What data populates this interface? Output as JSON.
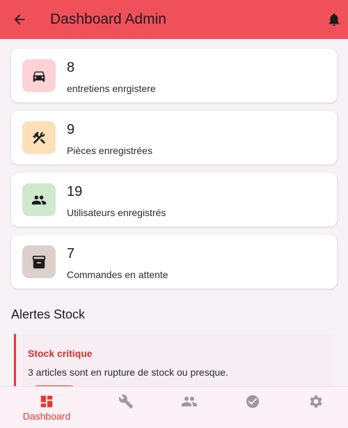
{
  "appbar": {
    "title": "Dashboard Admin"
  },
  "cards": [
    {
      "count": "8",
      "label": "entretiens enrgistere",
      "icon": "car-icon",
      "bg": "#fcd2d6",
      "fg": "#1d1b1e"
    },
    {
      "count": "9",
      "label": "Pièces enregistrées",
      "icon": "tools-icon",
      "bg": "#fde0b8",
      "fg": "#1d1b1e"
    },
    {
      "count": "19",
      "label": "Utilisateurs enregistrés",
      "icon": "people-icon",
      "bg": "#cfe9cf",
      "fg": "#1d1b1e"
    },
    {
      "count": "7",
      "label": "Commandes en attente",
      "icon": "archive-icon",
      "bg": "#dcd0cd",
      "fg": "#1d1b1e"
    }
  ],
  "alerts_section": {
    "title": "Alertes Stock",
    "alert": {
      "title": "Stock critique",
      "text": "3 articles sont en rupture de stock ou presque."
    }
  },
  "bottom_nav": {
    "items": [
      {
        "label": "Dashboard",
        "icon": "dashboard-icon",
        "active": true
      },
      {
        "label": "",
        "icon": "wrench-icon",
        "active": false
      },
      {
        "label": "",
        "icon": "people-icon",
        "active": false
      },
      {
        "label": "",
        "icon": "check-circle-icon",
        "active": false
      },
      {
        "label": "",
        "icon": "gear-icon",
        "active": false
      }
    ]
  },
  "colors": {
    "accent": "#f0505a",
    "alert_red": "#e53935",
    "inactive_nav": "#9e9a9c",
    "background": "#f7f2f5"
  }
}
